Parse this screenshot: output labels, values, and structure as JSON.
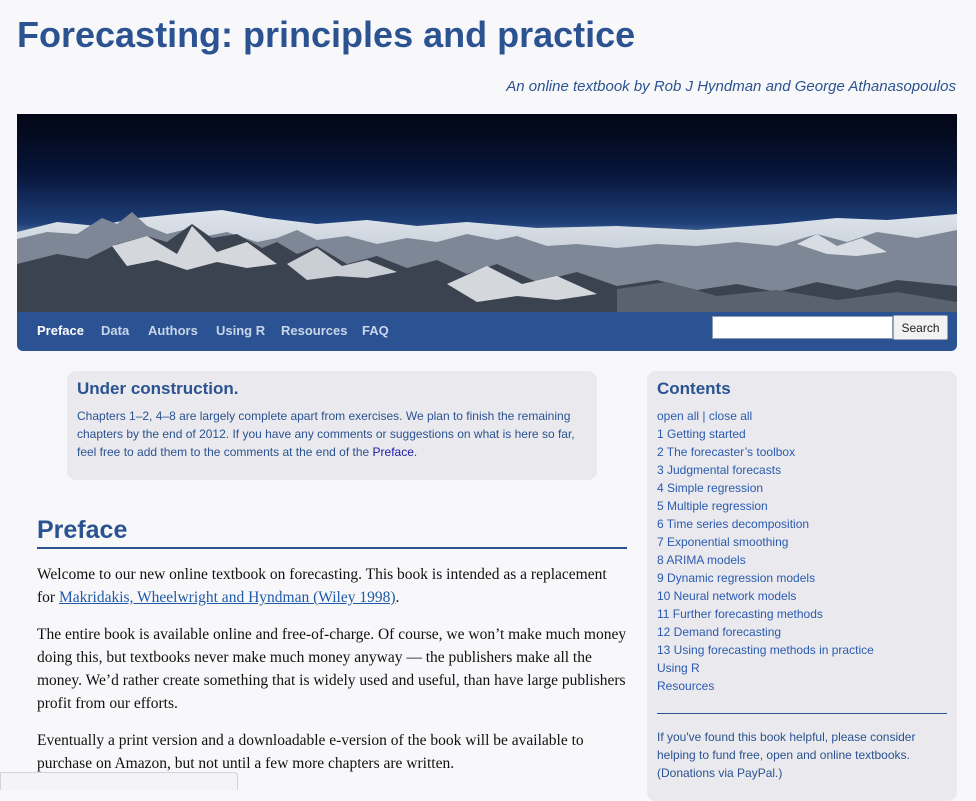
{
  "header": {
    "site_title": "Forecasting: principles and practice",
    "tagline": "An online textbook by Rob J Hyndman and George Athanasopoulos"
  },
  "nav": {
    "items": [
      "Preface",
      "Data",
      "Authors",
      "Using R",
      "Resources",
      "FAQ"
    ],
    "active": "Preface",
    "search_placeholder": "",
    "search_button": "Search"
  },
  "notice": {
    "title": "Under construction.",
    "text_before_link": "Chapters 1–2, 4–8 are largely complete apart from exercises. We plan to finish the remaining chapters by the end of 2012. If you have any comments or suggestions on what is here so far, feel free to add them to the comments at the end of the ",
    "link": "Preface",
    "text_after_link": "."
  },
  "main": {
    "heading": "Preface",
    "p1_before_link": "Welcome to our new online textbook on forecasting. This book is intended as a replacement for ",
    "p1_link": "Makridakis, Wheelwright and Hyndman (Wiley 1998)",
    "p1_after_link": ".",
    "p2": "The entire book is available online and free-of-charge. Of course, we won’t make much money doing this, but textbooks never make much money anyway — the publishers make all the money. We’d rather create something that is widely used and useful, than have large publishers profit from our efforts.",
    "p3": "Eventually a print version and a downloadable e-version of the book will be available to purchase on Amazon, but not until a few more chapters are written."
  },
  "sidebar": {
    "title": "Contents",
    "open_all": "open all",
    "separator": "|",
    "close_all": "close all",
    "toc": [
      "1 Getting started",
      "2 The forecaster’s toolbox",
      "3 Judgmental forecasts",
      "4 Simple regression",
      "5 Multiple regression",
      "6 Time series decomposition",
      "7 Exponential smoothing",
      "8 ARIMA models",
      "9 Dynamic regression models",
      "10 Neural network models",
      "11 Further forecasting methods",
      "12 Demand forecasting",
      "13 Using forecasting methods in practice",
      "Using R",
      "Resources"
    ],
    "donate_text": "If you've found this book helpful, please consider helping to fund free, open and online textbooks. (Donations via PayPal.)"
  },
  "colors": {
    "brand_blue": "#2b5391",
    "link_blue": "#2b5bb0",
    "panel_gray": "#e9e9ee"
  }
}
